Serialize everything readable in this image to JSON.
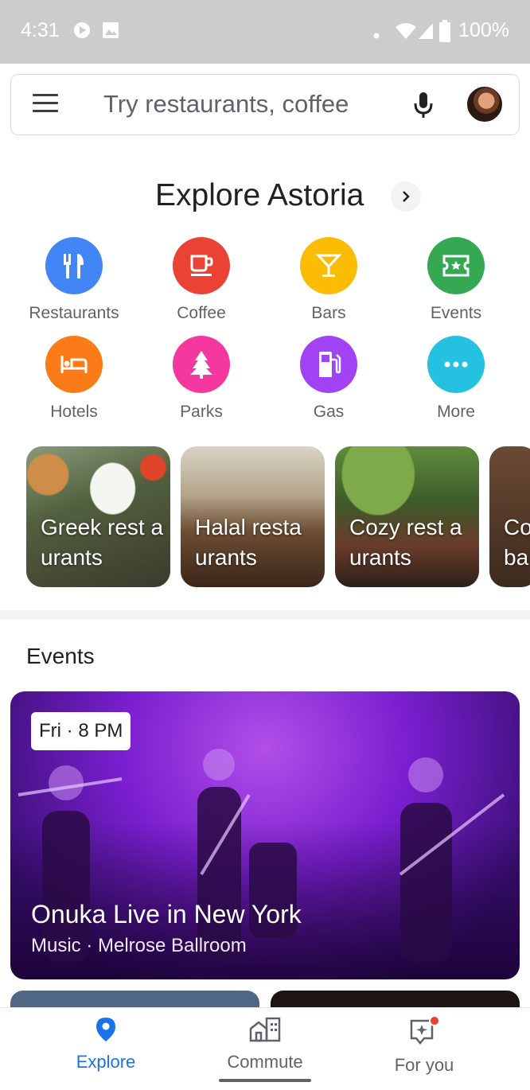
{
  "status_bar": {
    "time": "4:31",
    "battery": "100%",
    "icons": [
      "play-icon",
      "image-icon",
      "dot-icon",
      "wifi-icon",
      "signal-icon",
      "battery-icon"
    ]
  },
  "search": {
    "placeholder": "Try restaurants, coffee"
  },
  "explore": {
    "title": "Explore Astoria",
    "categories": [
      {
        "label": "Restaurants",
        "icon": "fork-knife-icon",
        "color": "#4285f4"
      },
      {
        "label": "Coffee",
        "icon": "coffee-cup-icon",
        "color": "#ea4335"
      },
      {
        "label": "Bars",
        "icon": "cocktail-icon",
        "color": "#fbbc04"
      },
      {
        "label": "Events",
        "icon": "ticket-icon",
        "color": "#34a853"
      },
      {
        "label": "Hotels",
        "icon": "bed-icon",
        "color": "#fa7b17"
      },
      {
        "label": "Parks",
        "icon": "tree-icon",
        "color": "#f538a0"
      },
      {
        "label": "Gas",
        "icon": "gas-pump-icon",
        "color": "#a142f4"
      },
      {
        "label": "More",
        "icon": "more-dots-icon",
        "color": "#24c1e0"
      }
    ],
    "cards": [
      {
        "label": "Greek rest aurants"
      },
      {
        "label": "Halal resta urants"
      },
      {
        "label": "Cozy rest aurants"
      },
      {
        "label": "Co ba"
      }
    ]
  },
  "events": {
    "heading": "Events",
    "featured": {
      "time": "Fri · 8 PM",
      "title": "Onuka Live in New York",
      "subtitle": "Music · Melrose Ballroom"
    }
  },
  "bottom_nav": {
    "items": [
      {
        "label": "Explore",
        "icon": "pin-icon",
        "active": true
      },
      {
        "label": "Commute",
        "icon": "commute-icon",
        "active": false
      },
      {
        "label": "For you",
        "icon": "for-you-icon",
        "active": false
      }
    ],
    "active_color": "#1a73e8"
  }
}
